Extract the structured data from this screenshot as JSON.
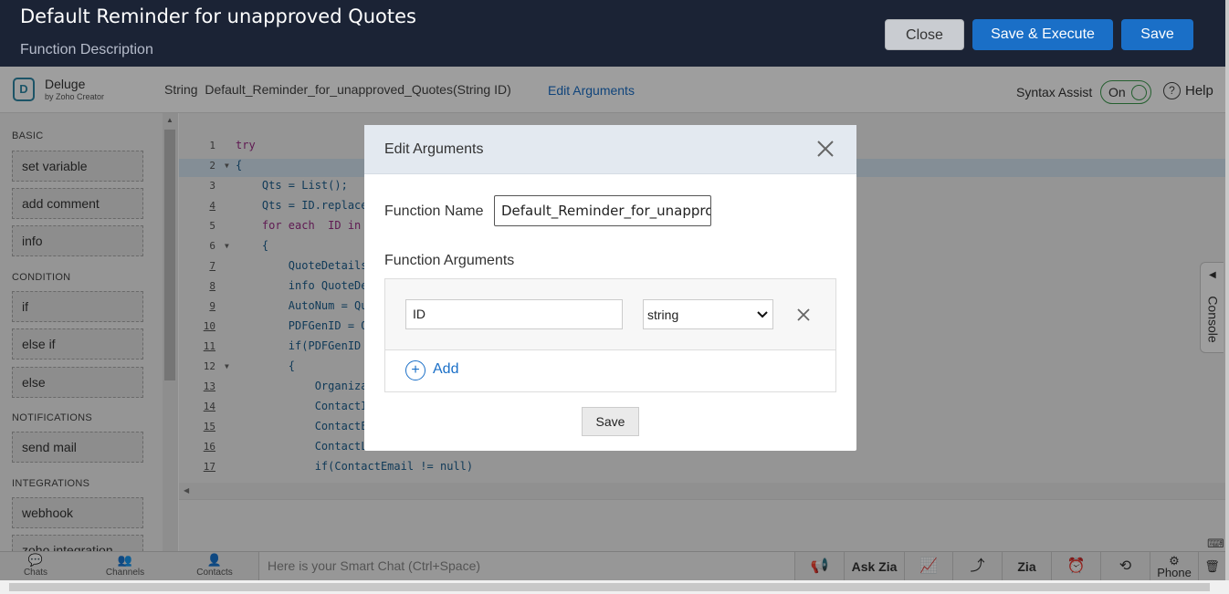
{
  "header": {
    "title": "Default Reminder for unapproved Quotes",
    "description": "Function Description",
    "close_label": "Close",
    "save_execute_label": "Save & Execute",
    "save_label": "Save"
  },
  "toolbar": {
    "logo_name": "Deluge",
    "logo_sub": "by Zoho Creator",
    "signature": "String  Default_Reminder_for_unapproved_Quotes(String ID)",
    "edit_arguments_label": "Edit Arguments",
    "syntax_assist_label": "Syntax Assist",
    "syntax_assist_state": "On",
    "help_label": "Help"
  },
  "sidebar": {
    "sections": [
      {
        "title": "BASIC",
        "items": [
          "set variable",
          "add comment",
          "info"
        ]
      },
      {
        "title": "CONDITION",
        "items": [
          "if",
          "else if",
          "else"
        ]
      },
      {
        "title": "NOTIFICATIONS",
        "items": [
          "send mail"
        ]
      },
      {
        "title": "INTEGRATIONS",
        "items": [
          "webhook",
          "zoho integration"
        ]
      }
    ]
  },
  "editor": {
    "lines": [
      {
        "n": "1",
        "code": "try"
      },
      {
        "n": "2",
        "code": "{"
      },
      {
        "n": "3",
        "code": "    Qts = List();"
      },
      {
        "n": "4",
        "code": "    Qts = ID.replace"
      },
      {
        "n": "5",
        "code": "    for each  ID in"
      },
      {
        "n": "6",
        "code": "    {"
      },
      {
        "n": "7",
        "code": "        QuoteDetails"
      },
      {
        "n": "8",
        "code": "        info QuoteDe"
      },
      {
        "n": "9",
        "code": "        AutoNum = Qu"
      },
      {
        "n": "10",
        "code": "        PDFGenID = Q"
      },
      {
        "n": "11",
        "code": "        if(PDFGenID"
      },
      {
        "n": "12",
        "code": "        {"
      },
      {
        "n": "13",
        "code": "            Organiza"
      },
      {
        "n": "14",
        "code": "            ContactI"
      },
      {
        "n": "15",
        "code": "            ContactE"
      },
      {
        "n": "16",
        "code": "            ContactL"
      },
      {
        "n": "17",
        "code": "            if(ContactEmail != null)"
      }
    ],
    "console_tab_label": "Console"
  },
  "bottom_bar": {
    "chats_label": "Chats",
    "channels_label": "Channels",
    "contacts_label": "Contacts",
    "smart_chat_placeholder": "Here is your Smart Chat (Ctrl+Space)",
    "ask_zia_label": "Ask Zia",
    "phone_label": "Phone"
  },
  "modal": {
    "title": "Edit Arguments",
    "function_name_label": "Function Name",
    "function_name_value": "Default_Reminder_for_unapproved_Quotes",
    "function_arguments_label": "Function Arguments",
    "argument_name": "ID",
    "argument_type": "string",
    "type_options": [
      "string"
    ],
    "add_label": "Add",
    "save_label": "Save"
  }
}
